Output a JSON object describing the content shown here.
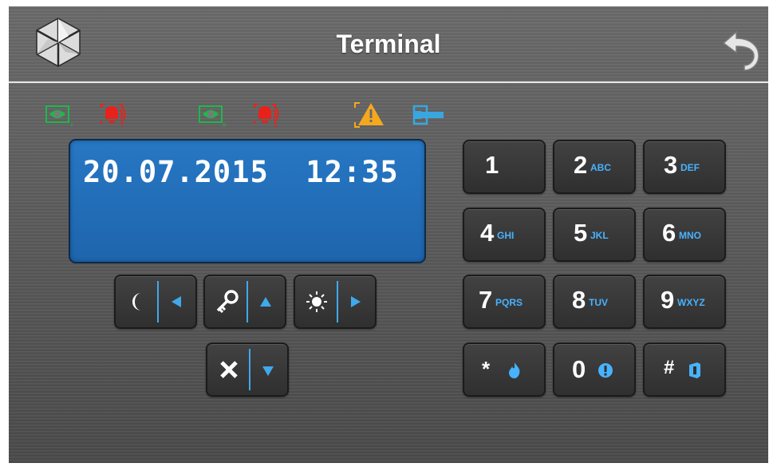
{
  "header": {
    "title": "Terminal"
  },
  "lcd": {
    "line1": "20.07.2015  12:35"
  },
  "status_icons": [
    {
      "name": "arm-status-1-icon",
      "color": "#1fb84a",
      "sub": "I"
    },
    {
      "name": "alarm-1-icon",
      "color": "#e8221b",
      "sub": "I"
    },
    {
      "name": "arm-status-2-icon",
      "color": "#1fb84a",
      "sub": "II"
    },
    {
      "name": "alarm-2-icon",
      "color": "#e8221b",
      "sub": "II"
    },
    {
      "name": "trouble-icon",
      "color": "#f5a81e"
    },
    {
      "name": "service-mode-icon",
      "color": "#39a6e0"
    }
  ],
  "keypad": {
    "k1": {
      "digit": "1",
      "letters": ""
    },
    "k2": {
      "digit": "2",
      "letters": "ABC"
    },
    "k3": {
      "digit": "3",
      "letters": "DEF"
    },
    "k4": {
      "digit": "4",
      "letters": "GHI"
    },
    "k5": {
      "digit": "5",
      "letters": "JKL"
    },
    "k6": {
      "digit": "6",
      "letters": "MNO"
    },
    "k7": {
      "digit": "7",
      "letters": "PQRS"
    },
    "k8": {
      "digit": "8",
      "letters": "TUV"
    },
    "k9": {
      "digit": "9",
      "letters": "WXYZ"
    },
    "kstar": {
      "digit": "*",
      "icon": "fire-icon"
    },
    "k0": {
      "digit": "0",
      "icon": "panic-icon"
    },
    "khash": {
      "digit": "#",
      "icon": "medical-icon"
    }
  },
  "nav_keys": [
    {
      "left_icon": "moon-icon",
      "right_icon": "arrow-left-icon"
    },
    {
      "left_icon": "key-icon",
      "right_icon": "arrow-up-icon"
    },
    {
      "left_icon": "sun-icon",
      "right_icon": "arrow-right-icon"
    },
    {
      "left_icon": "x-icon",
      "right_icon": "arrow-down-icon"
    }
  ],
  "colors": {
    "accent": "#3fa9ec",
    "lcd": "#2270bb",
    "letters": "#48b2ff"
  }
}
